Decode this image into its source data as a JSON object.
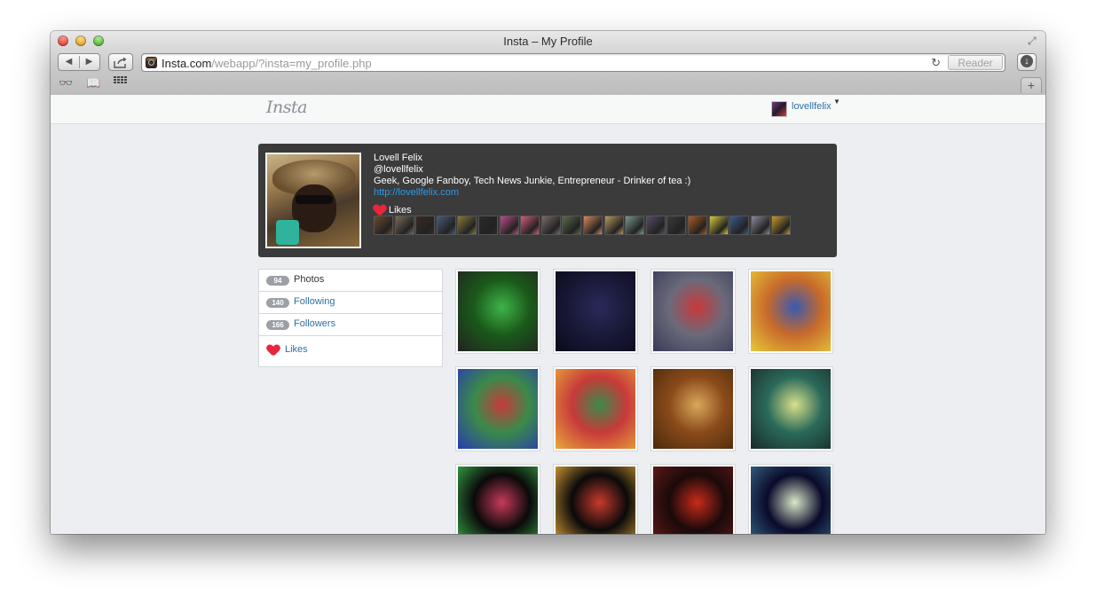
{
  "window": {
    "title": "Insta – My Profile"
  },
  "toolbar": {
    "back_icon": "◀",
    "forward_icon": "▶",
    "share_icon": "share-icon",
    "url_host": "Insta.com",
    "url_path": "/webapp/?insta=my_profile.php",
    "reload_icon": "reload-icon",
    "reader_label": "Reader"
  },
  "bookmarks": {
    "items": [
      "reading-list-icon",
      "bookmarks-icon",
      "top-sites-icon"
    ]
  },
  "site": {
    "logo": "Insta",
    "username": "lovellfelix"
  },
  "profile": {
    "name": "Lovell Felix",
    "handle": "@lovellfelix",
    "bio": "Geek, Google Fanboy, Tech News Junkie, Entrepreneur - Drinker of tea :)",
    "link": "http://lovellfelix.com",
    "likes_label": "Likes",
    "liked_thumbs": [
      "#6b4a2e",
      "#7a6a5a",
      "#3a2a22",
      "#4a5a7a",
      "#8a7a3a",
      "#2a2a2a",
      "#c04a8a",
      "#d85a7a",
      "#7a6a6a",
      "#5a6a4a",
      "#d88a5a",
      "#b89a5a",
      "#7a9a8a",
      "#5a4a6a",
      "#3a3a3a",
      "#b05a1a",
      "#d8c83a",
      "#3a5a8a",
      "#8a8a9a",
      "#c89a2a"
    ]
  },
  "sidebar": {
    "photos": {
      "count": "94",
      "label": "Photos"
    },
    "following": {
      "count": "140",
      "label": "Following"
    },
    "followers": {
      "count": "166",
      "label": "Followers"
    },
    "likes": {
      "label": "Likes"
    }
  },
  "photos": [
    {
      "colors": [
        "#1a5a1a",
        "#3fb34a",
        "#222"
      ]
    },
    {
      "colors": [
        "#1a1a3a",
        "#2a2a5a",
        "#0a0a1a"
      ]
    },
    {
      "colors": [
        "#6a6a7a",
        "#c83a3a",
        "#3a3a5a"
      ]
    },
    {
      "colors": [
        "#c86a2a",
        "#3a5ab0",
        "#e8c83a"
      ]
    },
    {
      "colors": [
        "#3a8a4a",
        "#c83a3a",
        "#2a3ab0"
      ]
    },
    {
      "colors": [
        "#c83a3a",
        "#3a8a4a",
        "#e8a83a"
      ]
    },
    {
      "colors": [
        "#8a4a1a",
        "#d8a85a",
        "#4a2a0a"
      ]
    },
    {
      "colors": [
        "#2a6a5a",
        "#d8e08a",
        "#1a2a2a"
      ]
    },
    {
      "colors": [
        "#0a0a0a",
        "#c83a5a",
        "#3ab04a"
      ]
    },
    {
      "colors": [
        "#0a0a0a",
        "#c83a2a",
        "#e8a83a"
      ]
    },
    {
      "colors": [
        "#1a0a0a",
        "#c82a1a",
        "#6a1a1a"
      ]
    },
    {
      "colors": [
        "#0a0a2a",
        "#d8e8c8",
        "#3a6a8a"
      ]
    }
  ]
}
